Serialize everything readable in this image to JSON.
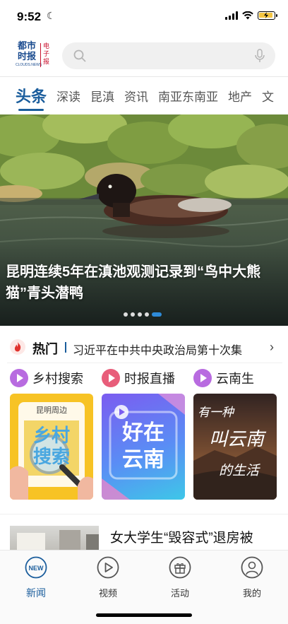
{
  "status_bar": {
    "time": "9:52"
  },
  "header": {
    "logo": {
      "main": "都市时报",
      "sub": "CLOUDS.NEWS",
      "side": "电子报"
    },
    "search_placeholder": ""
  },
  "tabs": [
    {
      "label": "头条",
      "active": true
    },
    {
      "label": "深读"
    },
    {
      "label": "昆滇"
    },
    {
      "label": "资讯"
    },
    {
      "label": "南亚东南亚"
    },
    {
      "label": "地产"
    },
    {
      "label": "文"
    }
  ],
  "hero": {
    "title": "昆明连续5年在滇池观测记录到“鸟中大熊猫”青头潜鸭",
    "slide_count": 5,
    "active_slide": 5
  },
  "hot": {
    "label": "热门",
    "headline": "习近平在中共中央政治局第十次集"
  },
  "channels": [
    {
      "label": "乡村搜索",
      "color": "#b86be0"
    },
    {
      "label": "时报直播",
      "color": "#e85d7a"
    },
    {
      "label": "云南生",
      "color": "#b86be0"
    }
  ],
  "cards": [
    {
      "top_text": "昆明周边",
      "big_text_1": "乡村",
      "big_text_2": "搜索"
    },
    {
      "big_text_1": "好在",
      "big_text_2": "云南"
    },
    {
      "script_text_1": "有一种",
      "script_text_2": "叫云南",
      "script_text_3": "的生活"
    }
  ],
  "news": [
    {
      "title": "女大学生“毁容式”退房被"
    }
  ],
  "bottom_nav": [
    {
      "label": "新闻",
      "badge": "NEW",
      "active": true
    },
    {
      "label": "视频"
    },
    {
      "label": "活动"
    },
    {
      "label": "我的"
    }
  ],
  "colors": {
    "brand_blue": "#1a5d9c",
    "logo_red": "#c8102e",
    "active_dot": "#2e8bd8"
  }
}
